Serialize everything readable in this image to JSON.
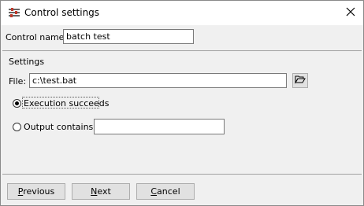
{
  "window": {
    "title": "Control settings",
    "icon": "settings-app-icon",
    "close_icon": "close-icon"
  },
  "control_name": {
    "label": "Control name:",
    "value": "batch test"
  },
  "settings": {
    "title": "Settings",
    "file": {
      "label": "File:",
      "value": "c:\\test.bat",
      "browse_icon": "folder-open-icon"
    },
    "options": [
      {
        "label": "Execution succeeds",
        "checked": true
      },
      {
        "label": "Output contains",
        "checked": false,
        "value": ""
      }
    ]
  },
  "buttons": {
    "previous": "Previous",
    "next": "Next",
    "cancel": "Cancel"
  }
}
